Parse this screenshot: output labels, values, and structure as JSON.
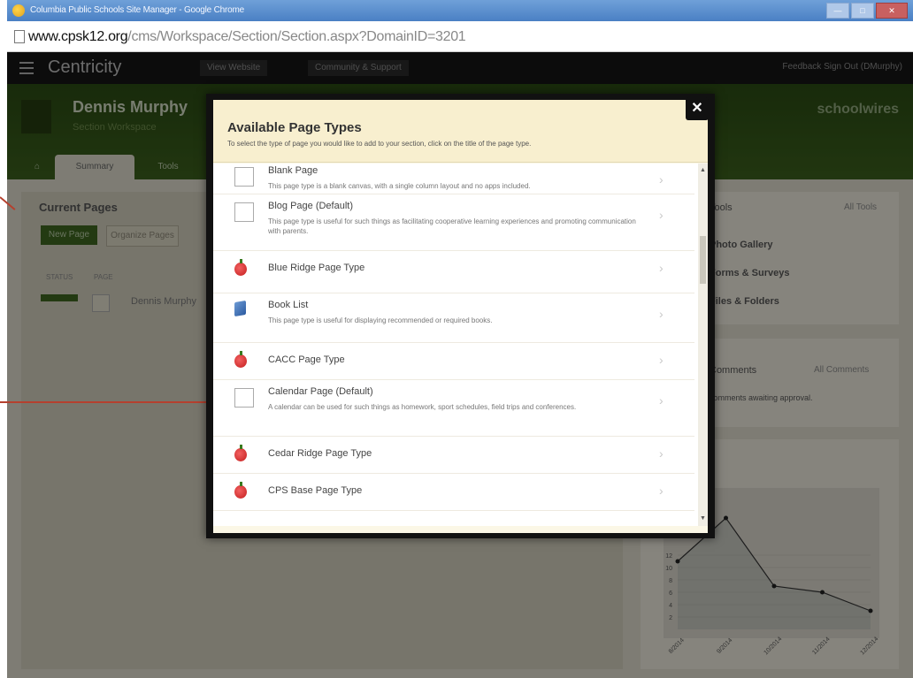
{
  "browser": {
    "window_title": "Columbia Public Schools Site Manager - Google Chrome",
    "url_host": "www.cpsk12.org",
    "url_path": "/cms/Workspace/Section/Section.aspx?DomainID=3201",
    "win_buttons": [
      "—",
      "□",
      "✕"
    ]
  },
  "topnav": {
    "brand": "Centricity",
    "view_website": "View Website",
    "community": "Community & Support",
    "right": "Feedback   Sign Out (DMurphy)"
  },
  "header": {
    "name": "Dennis Murphy",
    "subtitle": "Section Workspace",
    "logo": "schoolwires",
    "tabs": [
      "Summary",
      "Tools"
    ]
  },
  "left_panel": {
    "title": "Current Pages",
    "new_page": "New Page",
    "organize_pages": "Organize Pages",
    "col_status": "STATUS",
    "col_page": "PAGE",
    "row_name": "Dennis Murphy"
  },
  "right_panel": {
    "tools_title": "Tools",
    "tools_link": "All Tools",
    "tools_items": [
      "Photo Gallery",
      "Forms & Surveys",
      "Files & Folders"
    ],
    "comments_title": "Comments",
    "comments_link": "All Comments",
    "comments_text": "comments awaiting approval."
  },
  "modal": {
    "title": "Available Page Types",
    "description": "To select the type of page you would like to add to your section, click on the title of the page type.",
    "close": "✕",
    "chevron": "›",
    "scroll_up": "▲",
    "scroll_down": "▼",
    "items": [
      {
        "name": "Blank Page",
        "icon": "blank-page-icon",
        "desc": "This page type is a blank canvas, with a single column layout and no apps included."
      },
      {
        "name": "Blog Page (Default)",
        "icon": "blank-page-icon",
        "desc": "This page type is useful for such things as facilitating cooperative learning experiences and promoting communication with parents."
      },
      {
        "name": "Blue Ridge Page Type",
        "icon": "apple-icon",
        "desc": ""
      },
      {
        "name": "Book List",
        "icon": "book-icon",
        "desc": "This page type is useful for displaying recommended or required books."
      },
      {
        "name": "CACC Page Type",
        "icon": "apple-icon",
        "desc": ""
      },
      {
        "name": "Calendar Page (Default)",
        "icon": "blank-page-icon",
        "desc": "A calendar can be used for such things as homework, sport schedules, field trips and conferences."
      },
      {
        "name": "Cedar Ridge Page Type",
        "icon": "apple-icon",
        "desc": ""
      },
      {
        "name": "CPS Base Page Type",
        "icon": "apple-icon",
        "desc": ""
      }
    ]
  },
  "chart_data": {
    "type": "line",
    "x": [
      "8/2014",
      "9/2014",
      "10/2014",
      "11/2014",
      "12/2014"
    ],
    "values": [
      11,
      18,
      7,
      6,
      3
    ],
    "yticks": [
      2,
      4,
      6,
      8,
      10,
      12
    ],
    "ylim": [
      0,
      20
    ]
  },
  "colors": {
    "accent_green": "#3d6420",
    "arrow_red": "#b5402e",
    "modal_header": "#f8efcf"
  }
}
